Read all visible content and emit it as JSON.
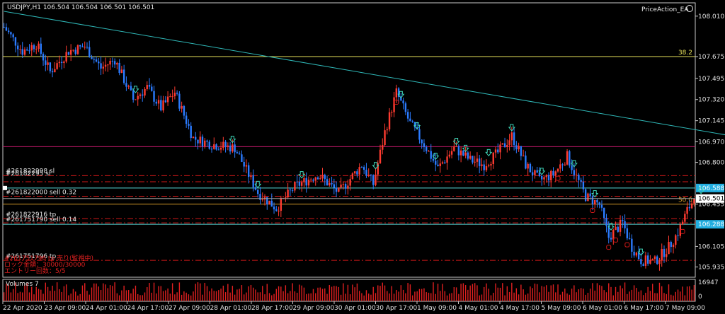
{
  "header": {
    "symbol_line": "USDJPY,H1  106.504 106.504 106.501 106.501",
    "ea_name": "PriceAction_EA",
    "ea_icon": "smiley-icon"
  },
  "colors": {
    "bull": "#ff3b30",
    "bear": "#2b7bff",
    "trend": "#2fb8b8",
    "fib_yellow": "#e6e05a",
    "magenta": "#c0186a",
    "cyan_line": "#56d8d8",
    "red_dash": "#d01818",
    "orange": "#d49a2a",
    "arrow": "#3fd6b8"
  },
  "chart_data": {
    "type": "candlestick",
    "symbol": "USDJPY",
    "timeframe": "H1",
    "ylim": [
      105.85,
      108.12
    ],
    "y_ticks": [
      "108.010",
      "107.675",
      "107.495",
      "107.320",
      "107.145",
      "106.970",
      "106.800",
      "106.455",
      "106.105",
      "105.935"
    ],
    "x_ticks": [
      "22 Apr 2020",
      "23 Apr 09:00",
      "24 Apr 01:00",
      "24 Apr 17:00",
      "27 Apr 09:00",
      "28 Apr 01:00",
      "28 Apr 17:00",
      "29 Apr 09:00",
      "30 Apr 01:00",
      "30 Apr 17:00",
      "1 May 09:00",
      "4 May 01:00",
      "4 May 17:00",
      "5 May 09:00",
      "6 May 01:00",
      "6 May 17:00",
      "7 May 09:00"
    ],
    "price_anchors": [
      [
        0,
        107.92
      ],
      [
        8,
        107.72
      ],
      [
        14,
        107.78
      ],
      [
        20,
        107.55
      ],
      [
        28,
        107.72
      ],
      [
        35,
        107.76
      ],
      [
        42,
        107.58
      ],
      [
        48,
        107.65
      ],
      [
        56,
        107.32
      ],
      [
        62,
        107.42
      ],
      [
        68,
        107.25
      ],
      [
        74,
        107.38
      ],
      [
        82,
        107.0
      ],
      [
        90,
        106.95
      ],
      [
        100,
        106.92
      ],
      [
        110,
        106.55
      ],
      [
        118,
        106.42
      ],
      [
        126,
        106.6
      ],
      [
        136,
        106.7
      ],
      [
        145,
        106.55
      ],
      [
        155,
        106.78
      ],
      [
        160,
        106.62
      ],
      [
        165,
        107.05
      ],
      [
        170,
        107.38
      ],
      [
        176,
        107.12
      ],
      [
        182,
        106.95
      ],
      [
        188,
        106.75
      ],
      [
        195,
        106.92
      ],
      [
        202,
        106.82
      ],
      [
        208,
        106.78
      ],
      [
        214,
        106.88
      ],
      [
        220,
        107.02
      ],
      [
        226,
        106.78
      ],
      [
        232,
        106.65
      ],
      [
        238,
        106.7
      ],
      [
        244,
        106.85
      ],
      [
        248,
        106.68
      ],
      [
        252,
        106.52
      ],
      [
        258,
        106.45
      ],
      [
        262,
        106.18
      ],
      [
        268,
        106.3
      ],
      [
        272,
        106.1
      ],
      [
        276,
        105.99
      ],
      [
        282,
        105.98
      ],
      [
        288,
        106.1
      ],
      [
        292,
        106.22
      ],
      [
        296,
        106.4
      ],
      [
        299,
        106.501
      ]
    ],
    "current_price": "106.501",
    "current_price_value": 106.501,
    "levels": [
      {
        "name": "fib-38.2-line",
        "price": 107.675,
        "style": "solid",
        "color": "#e6e05a",
        "label": "38.2"
      },
      {
        "name": "fib-50.0-line",
        "price": 106.455,
        "style": "solid",
        "color": "#d49a2a",
        "label": "50.0"
      },
      {
        "name": "magenta-line",
        "price": 106.93,
        "style": "solid",
        "color": "#c0186a"
      },
      {
        "name": "cyan-level-upper",
        "price": 106.588,
        "style": "solid",
        "color": "#56d8d8",
        "tag": "106.588"
      },
      {
        "name": "cyan-level-lower",
        "price": 106.288,
        "style": "solid",
        "color": "#56d8d8",
        "tag": "106.288"
      },
      {
        "name": "red-dash-1",
        "price": 106.69,
        "style": "dashdot",
        "color": "#d01818"
      },
      {
        "name": "red-dash-2",
        "price": 106.64,
        "style": "dashdot",
        "color": "#d01818"
      },
      {
        "name": "red-dash-3",
        "price": 106.52,
        "style": "dashdot",
        "color": "#d01818"
      },
      {
        "name": "red-dash-4",
        "price": 106.335,
        "style": "dashdot",
        "color": "#d01818"
      },
      {
        "name": "red-dash-5",
        "price": 106.3,
        "style": "dashdot",
        "color": "#d01818"
      },
      {
        "name": "red-dash-6",
        "price": 105.99,
        "style": "dashdot",
        "color": "#d01818"
      }
    ],
    "trendline": {
      "from": [
        0,
        108.05
      ],
      "to": [
        315,
        107.02
      ]
    },
    "down_arrows": [
      57,
      99,
      110,
      129,
      161,
      172,
      179,
      187,
      196,
      200,
      210,
      220,
      233,
      247,
      256,
      263,
      276,
      302
    ],
    "up_markers": [
      170,
      240,
      255,
      262,
      265,
      270,
      294
    ],
    "trade_labels": [
      {
        "text": "#261822998 sl",
        "price": 106.7
      },
      {
        "text": "#26182295 sl",
        "price": 106.68
      },
      {
        "text": "#261822000 sell 0.32",
        "price": 106.525
      },
      {
        "text": "#261822916 tp",
        "price": 106.34
      },
      {
        "text": "#261751790 sell 0.14",
        "price": 106.3
      },
      {
        "text": "#261751796 tp",
        "price": 105.995
      }
    ],
    "info_lines": [
      {
        "text": "#261751796 tp  売り(監視中)"
      },
      {
        "text": "ロック金額：30000/30000"
      },
      {
        "text": "エントリー回数：5/5"
      }
    ],
    "volume_panel": {
      "label": "Volumes 7",
      "max_label": "16947",
      "min_label": "0"
    }
  }
}
